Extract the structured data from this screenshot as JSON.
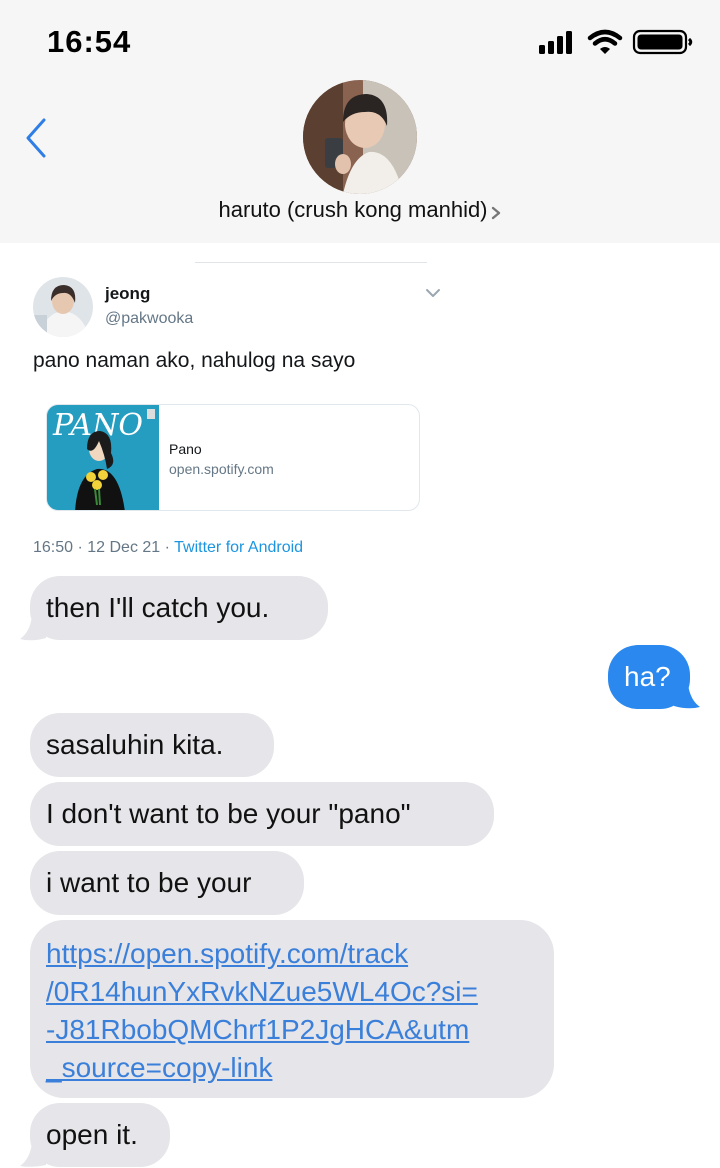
{
  "status_bar": {
    "time": "16:54"
  },
  "header": {
    "back_icon": "chevron-left-icon",
    "contact_name": "haruto (crush kong manhid)",
    "contact_chevron": "chevron-right-icon"
  },
  "tweet": {
    "display_name": "jeong",
    "handle": "@pakwooka",
    "text": "pano naman ako, nahulog na sayo",
    "card": {
      "art_text": "PANO",
      "title": "Pano",
      "domain": "open.spotify.com"
    },
    "meta": "16:50 · 12 Dec 21 · ",
    "source": "Twitter for Android"
  },
  "messages": [
    {
      "side": "received",
      "text": "then I'll catch you."
    },
    {
      "side": "sent",
      "text": "ha?"
    },
    {
      "side": "received",
      "text": "sasaluhin kita."
    },
    {
      "side": "received",
      "text": "I don't want to be your \"pano\""
    },
    {
      "side": "received",
      "text": "i want to be your"
    },
    {
      "side": "received",
      "link_lines": [
        "https://open.spotify.com/track",
        "/0R14hunYxRvkNZue5WL4Oc?si=",
        "-J81RbobQMChrf1P2JgHCA&utm",
        "_source=copy-link"
      ]
    },
    {
      "side": "received",
      "text": "open it."
    }
  ],
  "colors": {
    "header_bg": "#f6f6f6",
    "received_bubble": "#e5e5ea",
    "sent_bubble": "#2a88ee",
    "link": "#3a7fd9",
    "ios_blue": "#2f7ee6"
  }
}
